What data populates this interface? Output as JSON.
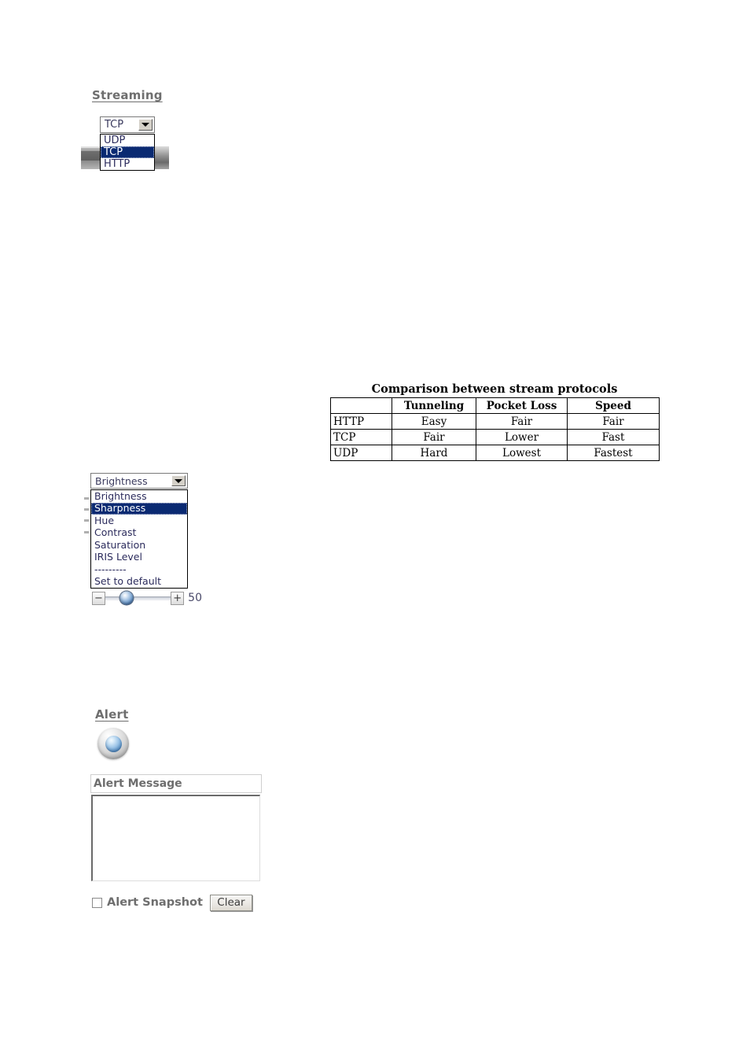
{
  "streaming": {
    "heading": "Streaming",
    "selected_value": "TCP",
    "options": [
      "UDP",
      "TCP",
      "HTTP"
    ],
    "highlighted_option": "TCP",
    "dropdown_arrow_icon": "chevron-down-icon"
  },
  "comparison_table": {
    "caption": "Comparison between stream protocols",
    "columns": [
      "",
      "Tunneling",
      "Pocket Loss",
      "Speed"
    ],
    "rows": [
      {
        "protocol": "HTTP",
        "tunneling": "Easy",
        "pocket_loss": "Fair",
        "speed": "Fair"
      },
      {
        "protocol": "TCP",
        "tunneling": "Fair",
        "pocket_loss": "Lower",
        "speed": "Fast"
      },
      {
        "protocol": "UDP",
        "tunneling": "Hard",
        "pocket_loss": "Lowest",
        "speed": "Fastest"
      }
    ]
  },
  "image_setting": {
    "selected_value": "Brightness",
    "options": [
      "Brightness",
      "Sharpness",
      "Hue",
      "Contrast",
      "Saturation",
      "IRIS Level",
      "---------",
      "Set to default"
    ],
    "highlighted_option": "Sharpness",
    "dropdown_arrow_icon": "chevron-down-icon",
    "slider": {
      "decrease_label": "−",
      "increase_label": "+",
      "value": "50",
      "percent": 32
    }
  },
  "alert": {
    "heading": "Alert",
    "button_icon": "alert-orb-icon",
    "message_label": "Alert Message",
    "message_value": "",
    "snapshot_label": "Alert Snapshot",
    "snapshot_checked": false,
    "clear_label": "Clear"
  },
  "colors": {
    "heading_grey": "#6e6e6e",
    "option_text": "#2b2b5c",
    "selection_blue": "#0a2a72",
    "slider_value_text": "#4a4a6a"
  }
}
